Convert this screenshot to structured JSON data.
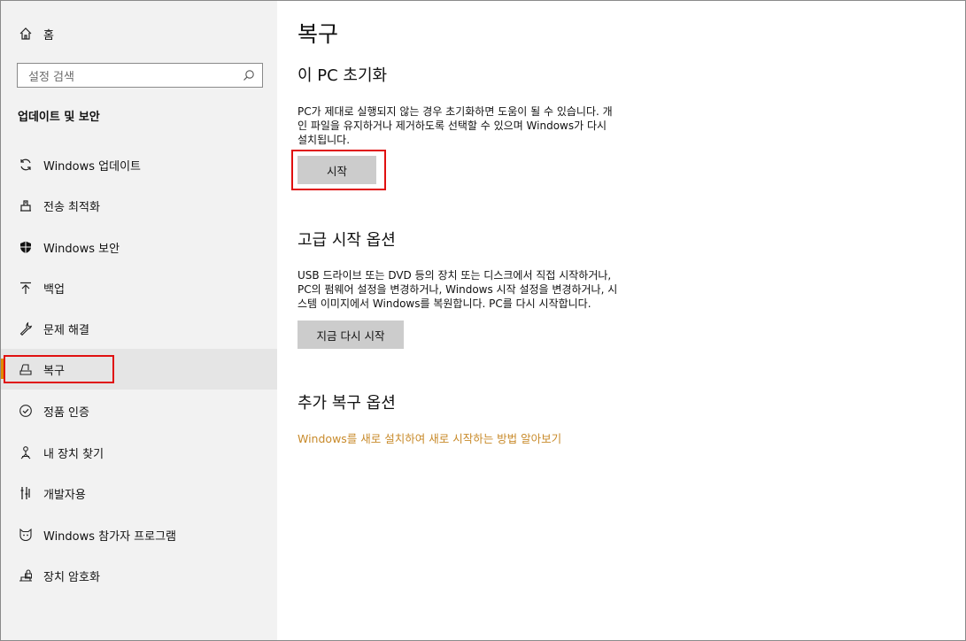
{
  "sidebar": {
    "home_label": "홈",
    "search_placeholder": "설정 검색",
    "section_title": "업데이트 및 보안",
    "items": [
      {
        "label": "Windows 업데이트",
        "icon": "refresh-icon"
      },
      {
        "label": "전송 최적화",
        "icon": "delivery-optimization-icon"
      },
      {
        "label": "Windows 보안",
        "icon": "shield-icon"
      },
      {
        "label": "백업",
        "icon": "backup-arrow-icon"
      },
      {
        "label": "문제 해결",
        "icon": "wrench-icon"
      },
      {
        "label": "복구",
        "icon": "recovery-icon",
        "selected": true
      },
      {
        "label": "정품 인증",
        "icon": "check-circle-icon"
      },
      {
        "label": "내 장치 찾기",
        "icon": "find-device-icon"
      },
      {
        "label": "개발자용",
        "icon": "developer-tools-icon"
      },
      {
        "label": "Windows 참가자 프로그램",
        "icon": "insider-cat-icon"
      },
      {
        "label": "장치 암호화",
        "icon": "device-lock-icon"
      }
    ]
  },
  "main": {
    "title": "복구",
    "reset": {
      "heading": "이 PC 초기화",
      "description_lines": [
        "PC가 제대로 실행되지 않는 경우 초기화하면 도움이 될 수 있습니다. 개",
        "인 파일을 유지하거나 제거하도록 선택할 수 있으며 Windows가 다시",
        "설치됩니다."
      ],
      "button": "시작"
    },
    "advanced": {
      "heading": "고급 시작 옵션",
      "description_lines": [
        "USB 드라이브 또는 DVD 등의 장치 또는 디스크에서 직접 시작하거나,",
        "PC의 펌웨어 설정을 변경하거나, Windows 시작 설정을 변경하거나, 시",
        "스템 이미지에서 Windows를 복원합니다. PC를 다시 시작합니다."
      ],
      "button": "지금 다시 시작"
    },
    "more": {
      "heading": "추가 복구 옵션",
      "link": "Windows를 새로 설치하여 새로 시작하는 방법 알아보기"
    }
  },
  "colors": {
    "sidebar_bg": "#f2f2f2",
    "selected_bg": "#e5e5e5",
    "accent": "#e08a00",
    "link": "#c88a2a",
    "highlight_box": "#e01010",
    "button_bg": "#cccccc"
  }
}
